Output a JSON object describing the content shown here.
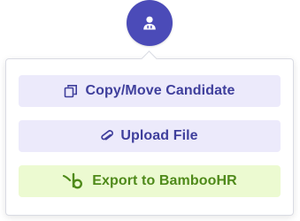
{
  "avatar": {
    "icon": "person-icon",
    "bg_color": "#4b4bb8"
  },
  "menu": {
    "items": [
      {
        "label": "Copy/Move Candidate",
        "icon": "copy-icon",
        "bg_color": "#eceafb",
        "text_color": "#3f3f9c"
      },
      {
        "label": "Upload File",
        "icon": "paperclip-icon",
        "bg_color": "#eceafb",
        "text_color": "#3f3f9c"
      },
      {
        "label": "Export to BambooHR",
        "icon": "bamboohr-icon",
        "bg_color": "#ecfad1",
        "text_color": "#4f8a1a"
      }
    ]
  }
}
